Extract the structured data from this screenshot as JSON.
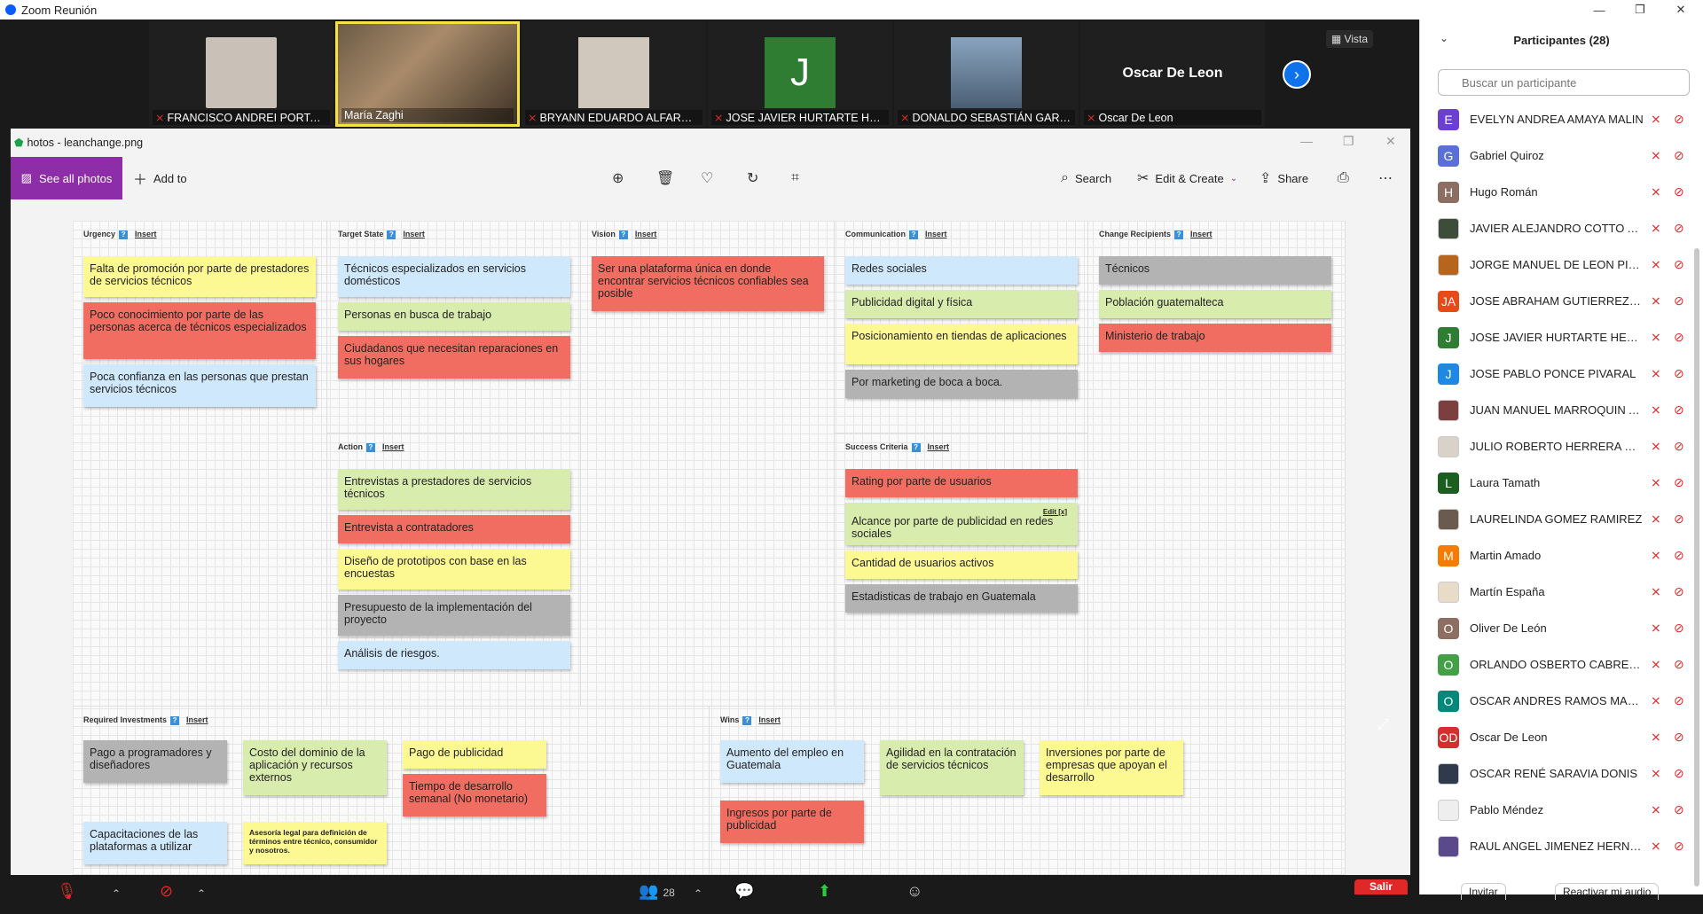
{
  "window": {
    "title": "Zoom Reunión",
    "minimize": "—",
    "restore": "❐",
    "close": "✕"
  },
  "strip": {
    "vista": "Vista",
    "tiles": [
      {
        "name": "FRANCISCO ANDREI PORTALE...",
        "bg": "#c9c1b7"
      },
      {
        "name": "María Zaghi",
        "bg": "#8a7157"
      },
      {
        "name": "BRYANN EDUARDO ALFARO ...",
        "bg": "#d0c8bd"
      },
      {
        "name": "JOSE JAVIER HURTARTE HERN...",
        "bg": "#2e7d32",
        "letter": "J"
      },
      {
        "name": "DONALDO SEBASTIÁN GARCÍ...",
        "bg": "#6e8aa6"
      },
      {
        "name": "Oscar De Leon",
        "big": "Oscar De Leon"
      }
    ],
    "next": "›"
  },
  "photos": {
    "title": "hotos - leanchange.png",
    "see_all": "See all photos",
    "add_to": "Add to",
    "search": "Search",
    "edit_create": "Edit & Create",
    "share": "Share"
  },
  "canvas": {
    "insert": "Insert",
    "urgency": {
      "label": "Urgency",
      "notes": [
        "Falta de promoción por parte de prestadores de servicios técnicos",
        "Poco conocimiento por parte de las personas acerca de técnicos especializados",
        "Poca confianza en las personas que prestan servicios técnicos"
      ]
    },
    "target": {
      "label": "Target State",
      "notes": [
        "Técnicos especializados en servicios domésticos",
        "Personas en busca de trabajo",
        "Ciudadanos que necesitan reparaciones en sus hogares"
      ]
    },
    "vision": {
      "label": "Vision",
      "notes": [
        "Ser una plataforma única en donde encontrar servicios técnicos confiables sea posible"
      ]
    },
    "communication": {
      "label": "Communication",
      "notes": [
        "Redes sociales",
        "Publicidad digital y física",
        "Posicionamiento en tiendas de aplicaciones",
        "Por marketing de boca a boca."
      ]
    },
    "recipients": {
      "label": "Change Recipients",
      "notes": [
        "Técnicos",
        "Población guatemalteca",
        "Ministerio de trabajo"
      ]
    },
    "action": {
      "label": "Action",
      "notes": [
        "Entrevistas a prestadores de servicios técnicos",
        "Entrevista a contratadores",
        "Diseño de prototipos con base en las encuestas",
        "Presupuesto de la implementación del proyecto",
        "Análisis de riesgos."
      ]
    },
    "success": {
      "label": "Success Criteria",
      "edit": "Edit",
      "x": "[x]",
      "notes": [
        "Rating por parte de usuarios",
        "Alcance por parte de publicidad en redes sociales",
        "Cantidad de usuarios activos",
        "Estadisticas de trabajo en Guatemala"
      ]
    },
    "investments": {
      "label": "Required Investments",
      "notes": [
        "Pago a programadores y diseñadores",
        "Costo del dominio de la aplicación y recursos externos",
        "Pago de publicidad",
        "Tiempo de desarrollo semanal (No monetario)",
        "Capacitaciones de las plataformas a utilizar",
        "Asesoría legal para definición de términos entre técnico, consumidor y nosotros."
      ]
    },
    "wins": {
      "label": "Wins",
      "notes": [
        "Aumento del empleo en Guatemala",
        "Agilidad en la contratación de servicios técnicos",
        "Inversiones por parte de empresas que apoyan el desarrollo",
        "Ingresos por parte de publicidad"
      ]
    }
  },
  "controls": {
    "participants_count": "28",
    "salir": "Salir"
  },
  "panel": {
    "title": "Participantes (28)",
    "search_placeholder": "Buscar un participante",
    "participants": [
      {
        "name": "EVELYN ANDREA AMAYA MALIN",
        "initials": "E",
        "color": "#6a3fd1"
      },
      {
        "name": "Gabriel Quiroz",
        "initials": "G",
        "color": "#5a6fd8"
      },
      {
        "name": "Hugo Román",
        "initials": "H",
        "color": "#8d6e63"
      },
      {
        "name": "JAVIER ALEJANDRO COTTO ARG...",
        "initials": "",
        "color": "#3e4d3a"
      },
      {
        "name": "JORGE MANUEL DE LEON PINE...",
        "initials": "",
        "color": "#b5651d"
      },
      {
        "name": "JOSE ABRAHAM GUTIERREZ CO...",
        "initials": "JA",
        "color": "#e64a19"
      },
      {
        "name": "JOSE JAVIER HURTARTE HERNA...",
        "initials": "J",
        "color": "#2e7d32"
      },
      {
        "name": "JOSE PABLO PONCE PIVARAL",
        "initials": "J",
        "color": "#1e88e5"
      },
      {
        "name": "JUAN MANUEL MARROQUIN A...",
        "initials": "",
        "color": "#7b3f3f"
      },
      {
        "name": "JULIO ROBERTO HERRERA SABAN",
        "initials": "",
        "color": "#d8d2c8"
      },
      {
        "name": "Laura Tamath",
        "initials": "L",
        "color": "#1b5e20"
      },
      {
        "name": "LAURELINDA GOMEZ RAMIREZ",
        "initials": "",
        "color": "#6b5a4e"
      },
      {
        "name": "Martin Amado",
        "initials": "M",
        "color": "#f57c00"
      },
      {
        "name": "Martín España",
        "initials": "",
        "color": "#e8dcc8"
      },
      {
        "name": "Oliver De León",
        "initials": "O",
        "color": "#8d6e63"
      },
      {
        "name": "ORLANDO OSBERTO CABRERA ...",
        "initials": "O",
        "color": "#43a047"
      },
      {
        "name": "OSCAR ANDRES RAMOS MALD...",
        "initials": "O",
        "color": "#00897b"
      },
      {
        "name": "Oscar De Leon",
        "initials": "OD",
        "color": "#d32f2f"
      },
      {
        "name": "OSCAR RENÉ SARAVIA DONIS",
        "initials": "",
        "color": "#2f3b4c"
      },
      {
        "name": "Pablo Méndez",
        "initials": "",
        "color": "#eeeeee"
      },
      {
        "name": "RAUL ANGEL JIMENEZ HERNAN...",
        "initials": "",
        "color": "#5a4a8a"
      }
    ],
    "invitar": "Invitar",
    "reactivar": "Reactivar mi audio"
  }
}
